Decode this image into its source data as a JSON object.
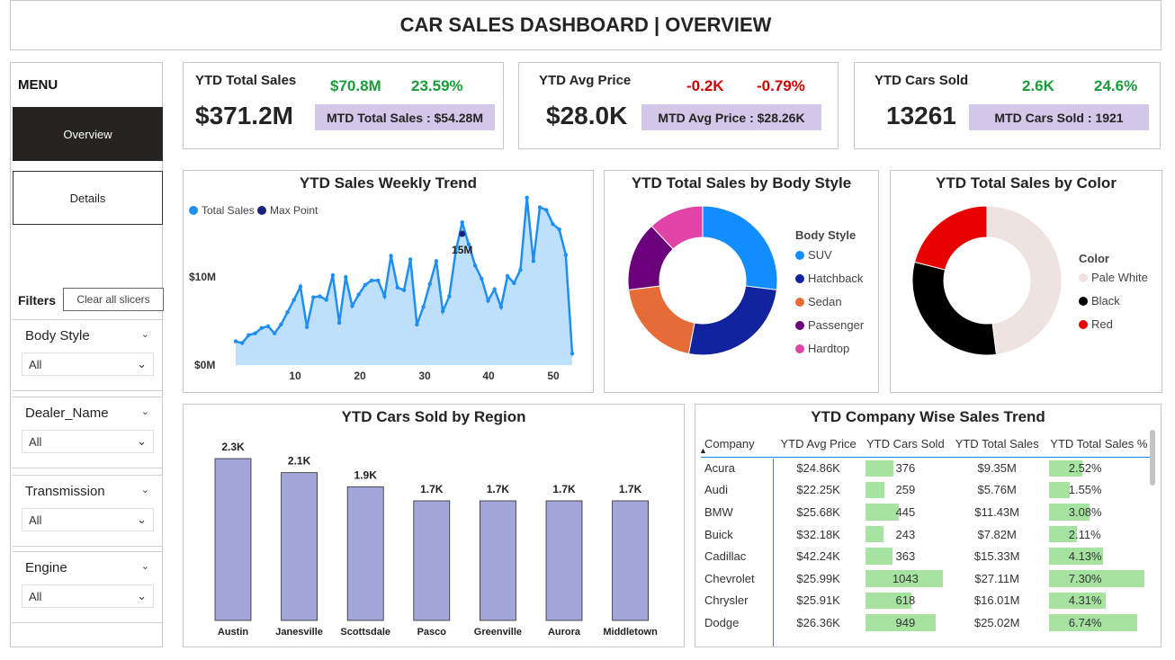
{
  "header": {
    "title": "CAR SALES DASHBOARD | OVERVIEW"
  },
  "menu": {
    "title": "MENU",
    "nav": [
      {
        "label": "Overview"
      },
      {
        "label": "Details"
      }
    ],
    "filters_label": "Filters",
    "clear_label": "Clear all slicers",
    "slicers": [
      {
        "title": "Body Style",
        "value": "All"
      },
      {
        "title": "Dealer_Name",
        "value": "All"
      },
      {
        "title": "Transmission",
        "value": "All"
      },
      {
        "title": "Engine",
        "value": "All"
      }
    ]
  },
  "kpis": [
    {
      "title": "YTD Total Sales",
      "value": "$371.2M",
      "delta1": "$70.8M",
      "delta2": "23.59%",
      "mtd": "MTD Total Sales : $54.28M"
    },
    {
      "title": "YTD Avg Price",
      "value": "$28.0K",
      "delta1": "-0.2K",
      "delta2": "-0.79%",
      "mtd": "MTD Avg Price : $28.26K"
    },
    {
      "title": "YTD Cars Sold",
      "value": "13261",
      "delta1": "2.6K",
      "delta2": "24.6%",
      "mtd": "MTD Cars Sold : 1921"
    }
  ],
  "colors": {
    "positive": "#1a9c3a",
    "negative": "#d10000",
    "mtd_bg": "#d3c8ea",
    "trend": "#1e8ff0",
    "max_point": "#1a237e"
  },
  "weekly": {
    "title": "YTD Sales Weekly Trend",
    "legend": [
      "Total Sales",
      "Max Point"
    ],
    "y_ticks": [
      "$10M",
      "$0M"
    ],
    "x_ticks": [
      "10",
      "20",
      "30",
      "40",
      "50"
    ],
    "max_label": "15M"
  },
  "body_style": {
    "title": "YTD Total Sales by Body Style",
    "legend_title": "Body Style",
    "items": [
      {
        "label": "SUV",
        "color": "#118dff",
        "share": 0.27
      },
      {
        "label": "Hatchback",
        "color": "#12239e",
        "share": 0.26
      },
      {
        "label": "Sedan",
        "color": "#e66c37",
        "share": 0.2
      },
      {
        "label": "Passenger",
        "color": "#6b007b",
        "share": 0.15
      },
      {
        "label": "Hardtop",
        "color": "#e044a7",
        "share": 0.12
      }
    ]
  },
  "color_chart": {
    "title": "YTD Total Sales by Color",
    "legend_title": "Color",
    "items": [
      {
        "label": "Pale White",
        "color": "#efe3e1",
        "share": 0.48
      },
      {
        "label": "Black",
        "color": "#000000",
        "share": 0.31
      },
      {
        "label": "Red",
        "color": "#e60000",
        "share": 0.21
      }
    ]
  },
  "region": {
    "title": "YTD Cars Sold by Region"
  },
  "company": {
    "title": "YTD Company Wise Sales Trend",
    "columns": [
      "Company",
      "YTD Avg Price",
      "YTD Cars Sold",
      "YTD Total Sales",
      "YTD Total Sales %"
    ],
    "rows": [
      {
        "company": "Acura",
        "avg": "$24.86K",
        "sold": "376",
        "sales": "$9.35M",
        "pct": "2.52%"
      },
      {
        "company": "Audi",
        "avg": "$22.25K",
        "sold": "259",
        "sales": "$5.76M",
        "pct": "1.55%"
      },
      {
        "company": "BMW",
        "avg": "$25.68K",
        "sold": "445",
        "sales": "$11.43M",
        "pct": "3.08%"
      },
      {
        "company": "Buick",
        "avg": "$32.18K",
        "sold": "243",
        "sales": "$7.82M",
        "pct": "2.11%"
      },
      {
        "company": "Cadillac",
        "avg": "$42.24K",
        "sold": "363",
        "sales": "$15.33M",
        "pct": "4.13%"
      },
      {
        "company": "Chevrolet",
        "avg": "$25.99K",
        "sold": "1043",
        "sales": "$27.11M",
        "pct": "7.30%"
      },
      {
        "company": "Chrysler",
        "avg": "$25.91K",
        "sold": "618",
        "sales": "$16.01M",
        "pct": "4.31%"
      },
      {
        "company": "Dodge",
        "avg": "$26.36K",
        "sold": "949",
        "sales": "$25.02M",
        "pct": "6.74%"
      }
    ]
  },
  "chart_data": [
    {
      "type": "area",
      "title": "YTD Sales Weekly Trend",
      "x": [
        1,
        2,
        3,
        4,
        5,
        6,
        7,
        8,
        9,
        10,
        11,
        12,
        13,
        14,
        15,
        16,
        17,
        18,
        19,
        20,
        21,
        22,
        23,
        24,
        25,
        26,
        27,
        28,
        29,
        30,
        31,
        32,
        33,
        34,
        35,
        36,
        37,
        38,
        39,
        40,
        41,
        42,
        43,
        44,
        45,
        46,
        47,
        48,
        49,
        50,
        51,
        52,
        53
      ],
      "series": [
        {
          "name": "Total Sales",
          "values": [
            2.7,
            2.5,
            3.4,
            3.6,
            4.2,
            4.4,
            3.6,
            4.6,
            6.0,
            7.4,
            8.9,
            4.3,
            7.7,
            7.8,
            7.4,
            10.2,
            4.8,
            10.0,
            6.7,
            8.0,
            9.1,
            9.6,
            9.6,
            7.8,
            12.4,
            8.8,
            8.5,
            12.0,
            4.6,
            6.6,
            9.2,
            11.8,
            6.1,
            7.8,
            12.9,
            16.2,
            13.7,
            11.3,
            9.8,
            7.3,
            8.6,
            6.6,
            10.1,
            9.3,
            10.8,
            19.0,
            11.8,
            17.9,
            17.6,
            16.0,
            15.4,
            12.5,
            1.3
          ]
        }
      ],
      "max_point": {
        "x": 36,
        "y": 15.0
      },
      "ylabel": "",
      "yticks": [
        "$0M",
        "$10M"
      ],
      "ylim": [
        0,
        20
      ]
    },
    {
      "type": "pie",
      "title": "YTD Total Sales by Body Style",
      "categories": [
        "SUV",
        "Hatchback",
        "Sedan",
        "Passenger",
        "Hardtop"
      ],
      "values": [
        0.27,
        0.26,
        0.2,
        0.15,
        0.12
      ]
    },
    {
      "type": "pie",
      "title": "YTD Total Sales by Color",
      "categories": [
        "Pale White",
        "Black",
        "Red"
      ],
      "values": [
        0.48,
        0.31,
        0.21
      ]
    },
    {
      "type": "bar",
      "title": "YTD Cars Sold by Region",
      "categories": [
        "Austin",
        "Janesville",
        "Scottsdale",
        "Pasco",
        "Greenville",
        "Aurora",
        "Middletown"
      ],
      "values": [
        2.3,
        2.1,
        1.9,
        1.7,
        1.7,
        1.7,
        1.7
      ],
      "labels": [
        "2.3K",
        "2.1K",
        "1.9K",
        "1.7K",
        "1.7K",
        "1.7K",
        "1.7K"
      ],
      "ylim": [
        0,
        2.5
      ]
    }
  ]
}
